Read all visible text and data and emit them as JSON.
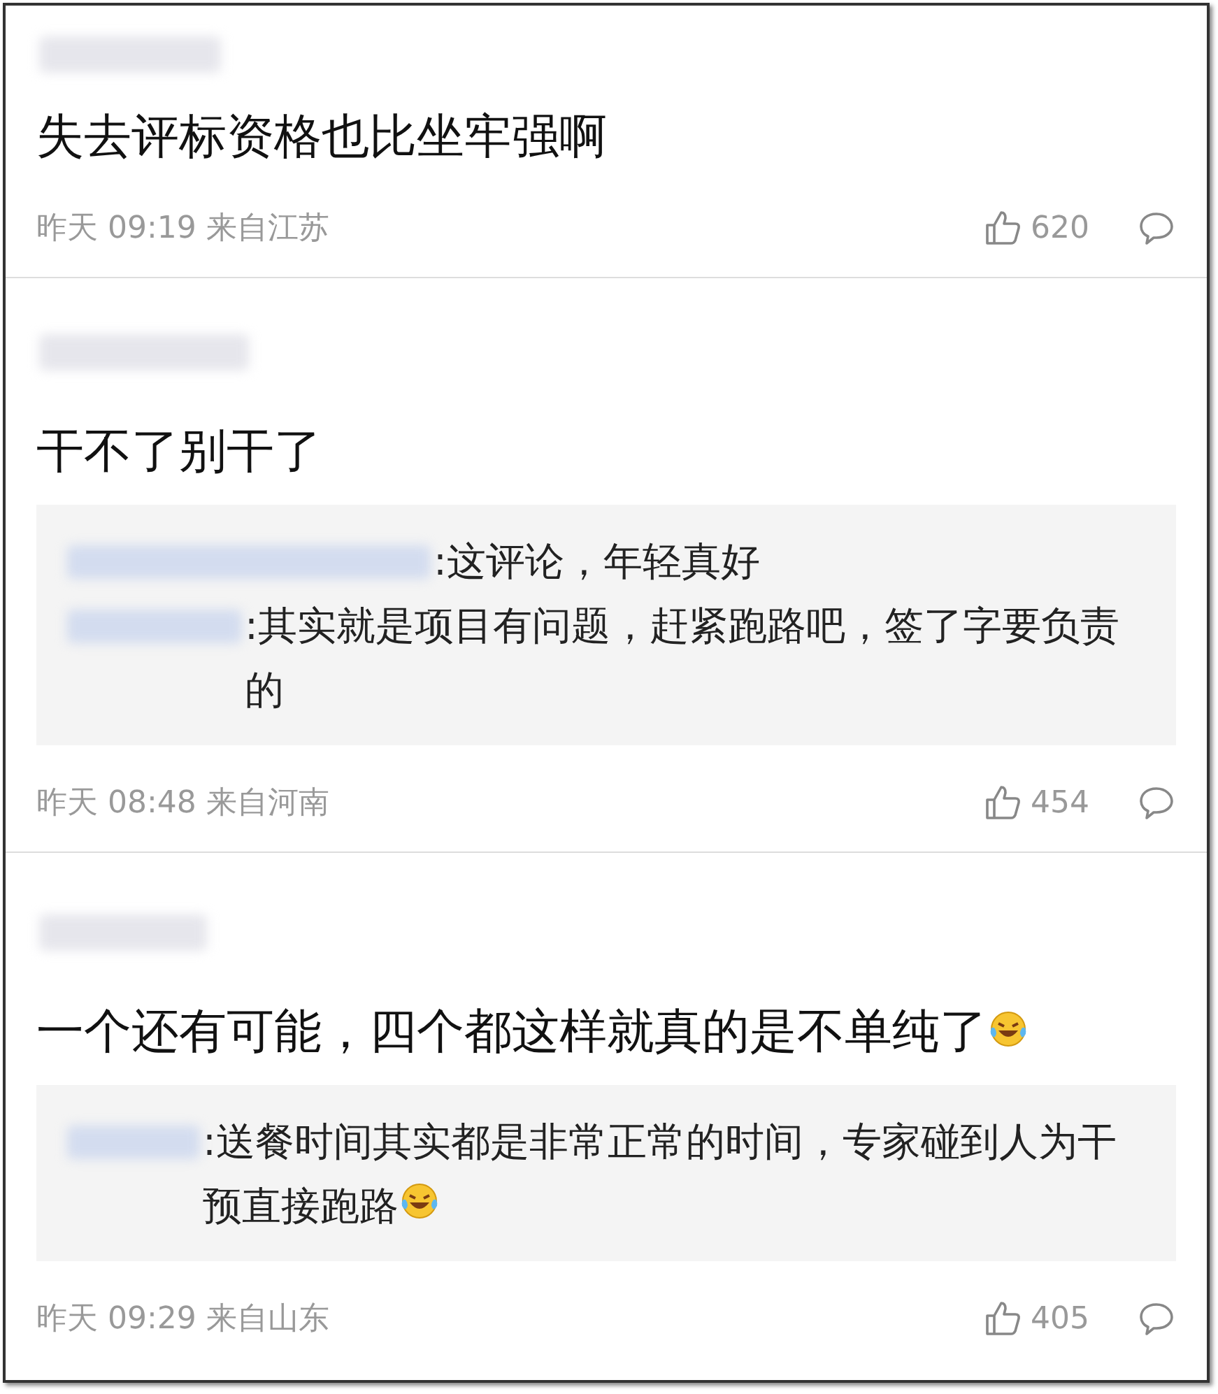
{
  "comments": [
    {
      "text": "失去评标资格也比坐牢强啊",
      "time": "昨天 09:19 来自江苏",
      "likes": "620"
    },
    {
      "text": "干不了别干了",
      "time": "昨天 08:48 来自河南",
      "likes": "454",
      "replies": [
        {
          "text": ":这评论，年轻真好"
        },
        {
          "text": ":其实就是项目有问题，赶紧跑路吧，签了字要负责的"
        }
      ]
    },
    {
      "text": "一个还有可能，四个都这样就真的是不单纯了",
      "laughing_emoji": true,
      "time": "昨天 09:29 来自山东",
      "likes": "405",
      "replies": [
        {
          "text": ":送餐时间其实都是非常正常的时间，专家碰到人为干预直接跑路",
          "laughing_emoji": true
        }
      ]
    }
  ]
}
